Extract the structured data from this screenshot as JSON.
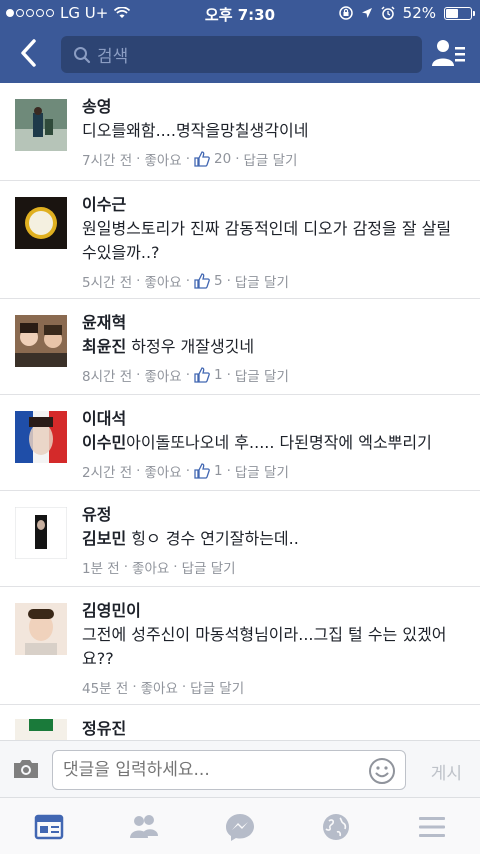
{
  "status_bar": {
    "carrier": "LG U+",
    "time": "오후 7:30",
    "battery": "52%",
    "battery_level": 0.52
  },
  "nav": {
    "search_placeholder": "검색"
  },
  "comments": [
    {
      "name": "송영",
      "text": "디오를왜함....명작을망칠생각이네",
      "mention": "",
      "time": "7시간 전",
      "like_label": "좋아요",
      "like_count": "20",
      "reply_label": "답글 달기"
    },
    {
      "name": "이수근",
      "text": "원일병스토리가 진짜 감동적인데 디오가 감정을 잘 살릴수있을까..?",
      "mention": "",
      "time": "5시간 전",
      "like_label": "좋아요",
      "like_count": "5",
      "reply_label": "답글 달기"
    },
    {
      "name": "윤재혁",
      "mention": "최윤진",
      "text": " 하정우 개잘생깃네",
      "time": "8시간 전",
      "like_label": "좋아요",
      "like_count": "1",
      "reply_label": "답글 달기"
    },
    {
      "name": "이대석",
      "mention": "이수민",
      "text": "아이돌또나오네 후..... 다된명작에 엑소뿌리기",
      "time": "2시간 전",
      "like_label": "좋아요",
      "like_count": "1",
      "reply_label": "답글 달기"
    },
    {
      "name": "유정",
      "mention": "김보민",
      "text": " 힝ㅇ 경수 연기잘하는데..",
      "time": "1분 전",
      "like_label": "좋아요",
      "like_count": "",
      "reply_label": "답글 달기"
    },
    {
      "name": "김영민이",
      "mention": "",
      "text": "그전에 성주신이 마동석형님이라...그집 털 수는 있겠어요??",
      "time": "45분 전",
      "like_label": "좋아요",
      "like_count": "",
      "reply_label": "답글 달기"
    },
    {
      "name": "정유진",
      "mention": "",
      "text": "",
      "time": "",
      "like_label": "",
      "like_count": "",
      "reply_label": ""
    }
  ],
  "composer": {
    "placeholder": "댓글을 입력하세요...",
    "post_label": "게시"
  },
  "tabs": [
    "news-feed",
    "friends",
    "messenger",
    "notifications",
    "more"
  ],
  "colors": {
    "brand": "#3b5998",
    "active_tab": "#4267b2",
    "inactive_tab": "#b6bcc9",
    "meta_text": "#90949c"
  }
}
